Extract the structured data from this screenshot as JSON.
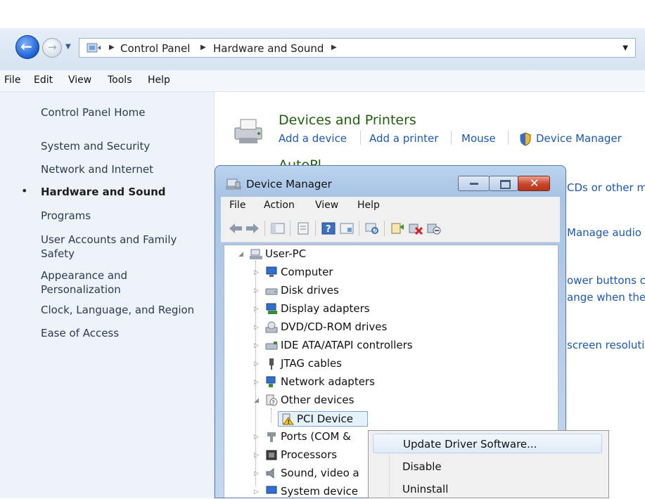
{
  "explorer": {
    "breadcrumb": [
      "Control Panel",
      "Hardware and Sound"
    ],
    "menu": [
      "File",
      "Edit",
      "View",
      "Tools",
      "Help"
    ]
  },
  "left_nav": {
    "items": [
      "Control Panel Home",
      "System and Security",
      "Network and Internet",
      "Hardware and Sound",
      "Programs",
      "User Accounts and Family Safety",
      "Appearance and Personalization",
      "Clock, Language, and Region",
      "Ease of Access"
    ],
    "current": "Hardware and Sound"
  },
  "main": {
    "devices_title": "Devices and Printers",
    "devices_links": [
      "Add a device",
      "Add a printer",
      "Mouse",
      "Device Manager"
    ],
    "autoplay_partial": "AutoPl",
    "partial_texts": [
      "CDs or other m",
      "Manage audio",
      "ower buttons c",
      "ange when the",
      "screen resoluti"
    ]
  },
  "device_manager": {
    "title": "Device Manager",
    "menu": [
      "File",
      "Action",
      "View",
      "Help"
    ],
    "tree": {
      "root": "User-PC",
      "items": [
        "Computer",
        "Disk drives",
        "Display adapters",
        "DVD/CD-ROM drives",
        "IDE ATA/ATAPI controllers",
        "JTAG cables",
        "Network adapters",
        "Other devices",
        "PCI Device",
        "Ports (COM &",
        "Processors",
        "Sound, video a",
        "System device"
      ]
    }
  },
  "context_menu": {
    "items": [
      "Update Driver Software...",
      "Disable",
      "Uninstall"
    ]
  },
  "colors": {
    "link_blue": "#1c57b5",
    "title_green": "#1e5f0b",
    "nav_bg": "#eef3fa",
    "close_red": "#c7462b"
  }
}
